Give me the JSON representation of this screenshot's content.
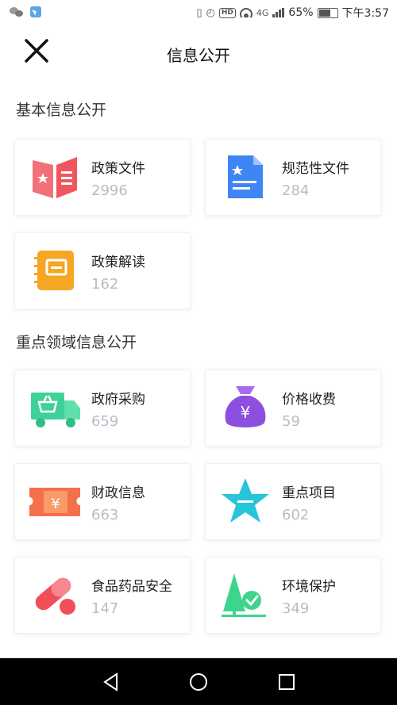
{
  "status_bar": {
    "net_label": "4G",
    "hd_label": "HD",
    "battery_percent": "65%",
    "time": "下午3:57"
  },
  "header": {
    "title": "信息公开"
  },
  "sections": [
    {
      "title": "基本信息公开",
      "items": [
        {
          "label": "政策文件",
          "count": "2996",
          "icon": "policy-book-icon"
        },
        {
          "label": "规范性文件",
          "count": "284",
          "icon": "document-star-icon"
        },
        {
          "label": "政策解读",
          "count": "162",
          "icon": "notebook-icon"
        }
      ]
    },
    {
      "title": "重点领域信息公开",
      "items": [
        {
          "label": "政府采购",
          "count": "659",
          "icon": "shopping-truck-icon"
        },
        {
          "label": "价格收费",
          "count": "59",
          "icon": "money-bag-icon"
        },
        {
          "label": "财政信息",
          "count": "663",
          "icon": "ticket-yuan-icon"
        },
        {
          "label": "重点项目",
          "count": "602",
          "icon": "star-icon"
        },
        {
          "label": "食品药品安全",
          "count": "147",
          "icon": "pill-icon"
        },
        {
          "label": "环境保护",
          "count": "349",
          "icon": "tree-check-icon"
        }
      ]
    }
  ],
  "colors": {
    "policy": "#f0565e",
    "document": "#3f86f5",
    "notebook": "#f5a623",
    "truck": "#3ed29a",
    "bag": "#8e4fe0",
    "ticket": "#f5704a",
    "star": "#28c4d8",
    "pill": "#f24e5a",
    "tree": "#3dd58d"
  }
}
